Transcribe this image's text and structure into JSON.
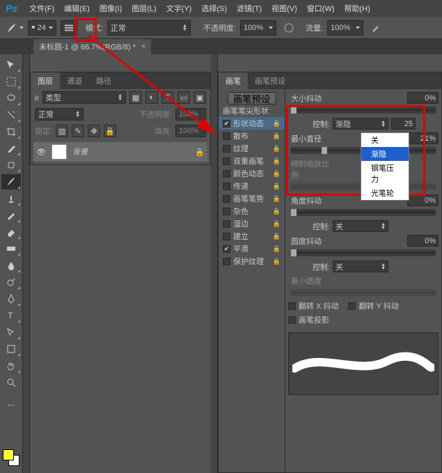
{
  "menu": [
    "文件(F)",
    "编辑(E)",
    "图像(I)",
    "图层(L)",
    "文字(Y)",
    "选择(S)",
    "滤镜(T)",
    "视图(V)",
    "窗口(W)",
    "帮助(H)"
  ],
  "options_bar": {
    "brush_size": "24",
    "mode_label": "模式:",
    "mode_value": "正常",
    "opacity_label": "不透明度:",
    "opacity_value": "100%",
    "flow_label": "流量:",
    "flow_value": "100%"
  },
  "doc_tab": {
    "title": "未标题-1 @ 66.7%(RGB/8) *"
  },
  "layers_panel": {
    "tabs": [
      "图层",
      "通道",
      "路径"
    ],
    "kind_label": "类型",
    "blend_mode": "正常",
    "opacity_label": "不透明度:",
    "opacity_value": "100%",
    "lock_label": "锁定:",
    "fill_label": "填充:",
    "fill_value": "100%",
    "layer_name": "背景"
  },
  "brush_panel": {
    "tabs": [
      "画笔",
      "画笔预设"
    ],
    "preset_button": "画笔预设",
    "tip_shape": "画笔笔尖形状",
    "options": [
      {
        "label": "形状动态",
        "checked": true,
        "locked": true,
        "selected": true
      },
      {
        "label": "散布",
        "checked": false,
        "locked": true
      },
      {
        "label": "纹理",
        "checked": false,
        "locked": true
      },
      {
        "label": "双重画笔",
        "checked": false,
        "locked": true
      },
      {
        "label": "颜色动态",
        "checked": false,
        "locked": true
      },
      {
        "label": "传递",
        "checked": false,
        "locked": true
      },
      {
        "label": "画笔笔势",
        "checked": false,
        "locked": true
      },
      {
        "label": "杂色",
        "checked": false,
        "locked": true
      },
      {
        "label": "湿边",
        "checked": false,
        "locked": true
      },
      {
        "label": "建立",
        "checked": false,
        "locked": true
      },
      {
        "label": "平滑",
        "checked": true,
        "locked": true
      },
      {
        "label": "保护纹理",
        "checked": false,
        "locked": true
      }
    ],
    "right": {
      "size_jitter_label": "大小抖动",
      "size_jitter_value": "0%",
      "control1_label": "控制:",
      "control1_value": "渐隐",
      "control1_steps": "25",
      "min_diam_label": "最小直径",
      "min_diam_value": "21%",
      "dropdown_options": [
        "关",
        "渐隐",
        "钢笔压力",
        "光笔轮"
      ],
      "tilt_scale_label": "倾斜缩放比例",
      "angle_jitter_label": "角度抖动",
      "angle_jitter_value": "0%",
      "control2_label": "控制:",
      "control2_value": "关",
      "round_jitter_label": "圆度抖动",
      "round_jitter_value": "0%",
      "control3_label": "控制:",
      "control3_value": "关",
      "min_round_label": "最小圆度",
      "flip_x_label": "翻转 X 抖动",
      "flip_y_label": "翻转 Y 抖动",
      "proj_label": "画笔投影"
    }
  }
}
